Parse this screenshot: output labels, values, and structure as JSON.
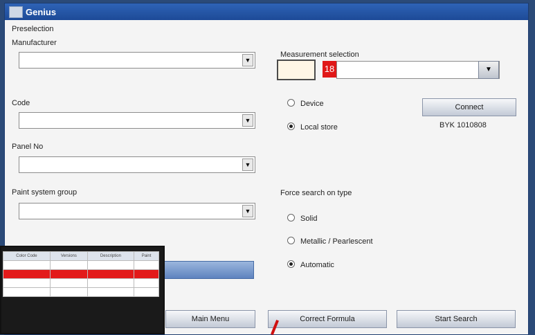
{
  "window": {
    "title": "Genius"
  },
  "preselection": {
    "heading": "Preselection",
    "manufacturer_label": "Manufacturer",
    "code_label": "Code",
    "panel_label": "Panel No",
    "paint_group_label": "Paint system group"
  },
  "measurement": {
    "label": "Measurement selection",
    "red_value": "18",
    "source_device": "Device",
    "source_local": "Local store",
    "selected_source": "Local store",
    "connect_label": "Connect",
    "device_id": "BYK 1010808"
  },
  "force_search": {
    "label": "Force search on type",
    "options": [
      "Solid",
      "Metallic / Pearlescent",
      "Automatic"
    ],
    "selected": "Automatic"
  },
  "buttons": {
    "main_menu": "Main Menu",
    "correct_formula": "Correct Formula",
    "start_search": "Start Search"
  },
  "inset_table": {
    "headers": [
      "Color Code",
      "Versions",
      "Description",
      "Paint"
    ],
    "rows": [
      [
        "",
        "",
        "",
        ""
      ],
      [
        "",
        "",
        "",
        ""
      ],
      [
        "",
        "",
        "",
        ""
      ],
      [
        "",
        "",
        "",
        ""
      ]
    ],
    "selected_row": 1
  },
  "colors": {
    "accent_red": "#e01818",
    "title_blue": "#1d4a97"
  }
}
